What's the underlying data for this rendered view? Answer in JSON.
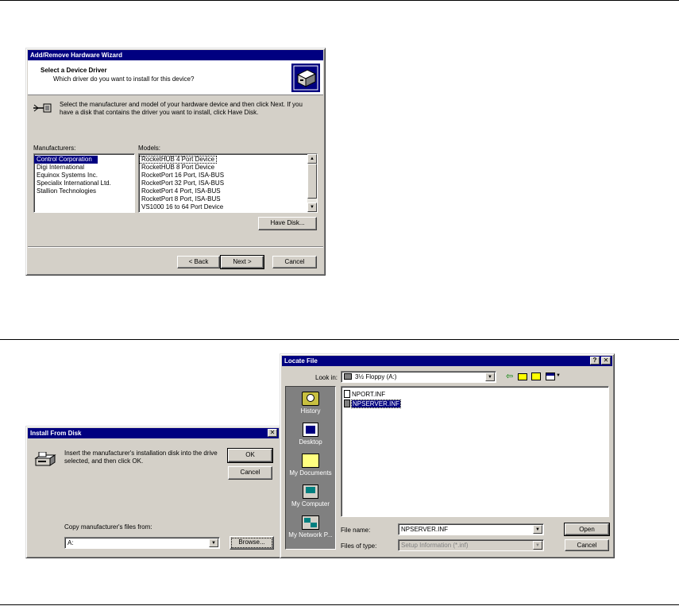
{
  "wizard": {
    "title": "Add/Remove Hardware Wizard",
    "heading": "Select a Device Driver",
    "subheading": "Which driver do you want to install for this device?",
    "instructions_line1": "Select the manufacturer and model of your hardware device and then click Next. If you",
    "instructions_line2": "have a disk that contains the driver you want to install, click Have Disk.",
    "manufacturers_label": "Manufacturers:",
    "manufacturers": [
      "Control Corporation",
      "Digi International",
      "Equinox Systems Inc.",
      "Specialix International Ltd.",
      "Stallion Technologies"
    ],
    "models_label": "Models:",
    "models": [
      "RocketHUB 4 Port Device",
      "RocketHUB 8 Port Device",
      "RocketPort 16 Port, ISA-BUS",
      "RocketPort 32 Port, ISA-BUS",
      "RocketPort 4 Port, ISA-BUS",
      "RocketPort 8 Port, ISA-BUS",
      "VS1000 16 to 64 Port Device"
    ],
    "have_disk": "Have Disk...",
    "back": "< Back",
    "next": "Next >",
    "cancel": "Cancel"
  },
  "install_disk": {
    "title": "Install From Disk",
    "message_line1": "Insert the manufacturer's installation disk into the drive",
    "message_line2": "selected, and then click OK.",
    "ok": "OK",
    "cancel": "Cancel",
    "copy_label": "Copy manufacturer's files from:",
    "copy_value": "A:",
    "browse": "Browse..."
  },
  "locate": {
    "title": "Locate File",
    "help_btn": "?",
    "close_btn": "✕",
    "look_in_label": "Look in:",
    "look_in_value": "3½ Floppy (A:)",
    "places": [
      "History",
      "Desktop",
      "My Documents",
      "My Computer",
      "My Network P..."
    ],
    "files": [
      "NPORT.INF",
      "NPSERVER.INF"
    ],
    "file_name_label": "File name:",
    "file_name_value": "NPSERVER.INF",
    "file_type_label": "Files of type:",
    "file_type_value": "Setup Information (*.inf)",
    "open": "Open",
    "cancel": "Cancel"
  },
  "colors": {
    "title_bar": "#000080",
    "face": "#d4d0c8",
    "places_bar": "#808080"
  }
}
